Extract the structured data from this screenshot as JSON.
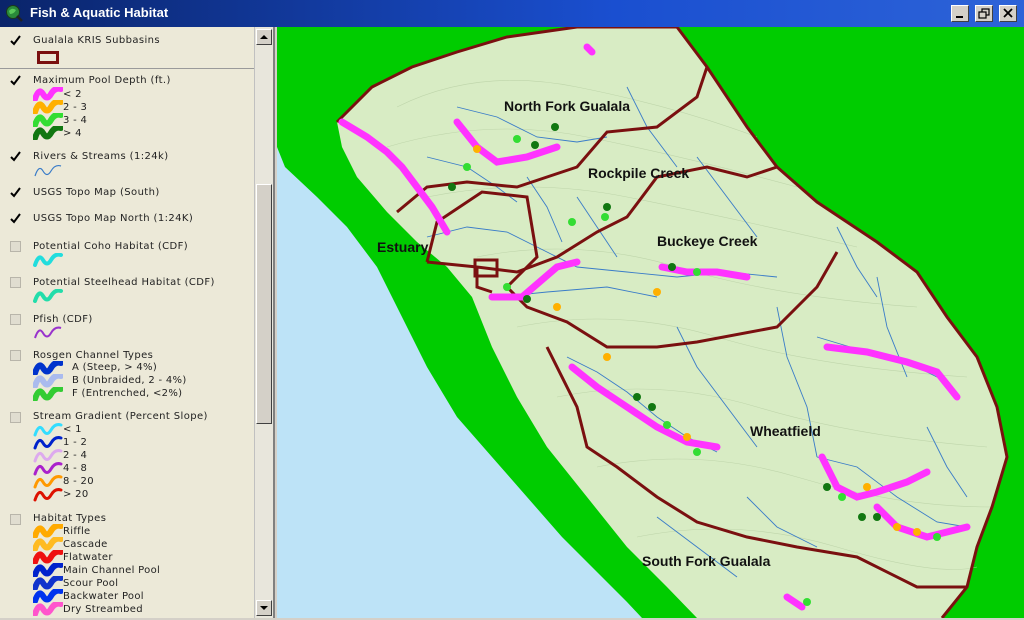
{
  "window": {
    "title": "Fish & Aquatic Habitat"
  },
  "legend": {
    "layers": [
      {
        "name": "Gualala KRIS Subbasins",
        "checked": true
      },
      {
        "name": "Maximum Pool Depth (ft.)",
        "checked": true,
        "classes": [
          {
            "label": "< 2",
            "color": "#ff33ff"
          },
          {
            "label": "2 - 3",
            "color": "#ffb000"
          },
          {
            "label": "3 - 4",
            "color": "#33dd33"
          },
          {
            "label": "> 4",
            "color": "#117711"
          }
        ]
      },
      {
        "name": "Rivers & Streams (1:24k)",
        "checked": true
      },
      {
        "name": "USGS Topo Map (South)",
        "checked": true
      },
      {
        "name": "USGS Topo Map North (1:24K)",
        "checked": true
      },
      {
        "name": "Potential Coho Habitat (CDF)",
        "checked": false
      },
      {
        "name": "Potential Steelhead Habitat (CDF)",
        "checked": false
      },
      {
        "name": "Pfish (CDF)",
        "checked": false
      },
      {
        "name": "Rosgen Channel Types",
        "checked": false,
        "classes": [
          {
            "label": "A  (Steep, > 4%)",
            "color": "#0033cc"
          },
          {
            "label": "B  (Unbraided, 2 - 4%)",
            "color": "#aabbee"
          },
          {
            "label": "F  (Entrenched, <2%)",
            "color": "#33cc33"
          }
        ]
      },
      {
        "name": "Stream Gradient (Percent Slope)",
        "checked": false,
        "classes": [
          {
            "label": "< 1",
            "color": "#33ddff"
          },
          {
            "label": "1 - 2",
            "color": "#0022cc"
          },
          {
            "label": "2 - 4",
            "color": "#ddaaee"
          },
          {
            "label": "4 - 8",
            "color": "#aa22cc"
          },
          {
            "label": "8 - 20",
            "color": "#ff9900"
          },
          {
            "label": "> 20",
            "color": "#dd1100"
          }
        ]
      },
      {
        "name": "Habitat Types",
        "checked": false,
        "classes": [
          {
            "label": "Riffle",
            "color": "#ffaa00"
          },
          {
            "label": "Cascade",
            "color": "#ffbb22"
          },
          {
            "label": "Flatwater",
            "color": "#ee1111"
          },
          {
            "label": "Main Channel Pool",
            "color": "#0022cc"
          },
          {
            "label": "Scour Pool",
            "color": "#1133cc"
          },
          {
            "label": "Backwater Pool",
            "color": "#0033ee"
          },
          {
            "label": "Dry Streambed",
            "color": "#ff55cc"
          }
        ]
      }
    ]
  },
  "map": {
    "labels": {
      "north_fork": "North Fork Gualala",
      "rockpile": "Rockpile Creek",
      "buckeye": "Buckeye Creek",
      "estuary": "Estuary",
      "wheatfield": "Wheatfield",
      "south_fork": "South Fork Gualala"
    },
    "colors": {
      "ocean": "#bde3f7",
      "land": "#00cc00",
      "basin": "#d8ecc4",
      "boundary": "#7a1010",
      "streams": "#3a7cc8"
    }
  }
}
